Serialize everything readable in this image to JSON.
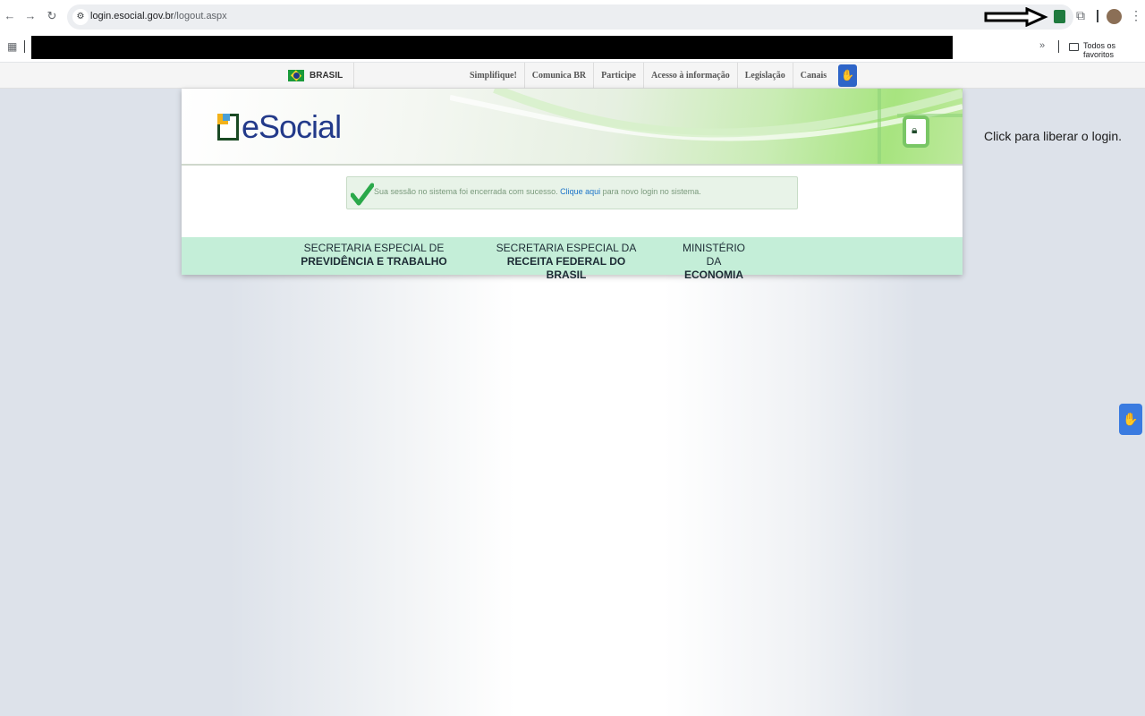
{
  "browser": {
    "url_host": "login.esocial.gov.br",
    "url_path": "/logout.aspx",
    "back_icon": "arrow-left-icon",
    "forward_icon": "arrow-right-icon",
    "reload_icon": "reload-icon",
    "site_info_icon": "tune-icon",
    "extensions_icon": "puzzle-icon",
    "menu_icon": "kebab-menu-icon"
  },
  "bookmarks": {
    "overflow_label": "»",
    "all_bookmarks_label": "Todos os favoritos"
  },
  "govbar": {
    "brasil_label": "BRASIL",
    "links": [
      "Simplifique!",
      "Comunica BR",
      "Participe",
      "Acesso à informação",
      "Legislação",
      "Canais"
    ]
  },
  "header": {
    "logo_text": "eSocial"
  },
  "message": {
    "text_before": "Sua sessão no sistema foi encerrada com sucesso.",
    "link_text": "Clique aqui",
    "text_after": "para novo login no sistema."
  },
  "footer": {
    "items": [
      {
        "line1": "SECRETARIA ESPECIAL DE",
        "line2": "PREVIDÊNCIA E TRABALHO"
      },
      {
        "line1": "SECRETARIA ESPECIAL DA",
        "line2": "RECEITA FEDERAL DO BRASIL"
      },
      {
        "line1": "MINISTÉRIO DA",
        "line2": "ECONOMIA"
      }
    ]
  },
  "side_hint": "Click para liberar o login.",
  "colors": {
    "brand_blue": "#233a8a",
    "footer_band": "#c4eed8",
    "success_green": "#2aa84a",
    "link_blue": "#1a73c8"
  }
}
